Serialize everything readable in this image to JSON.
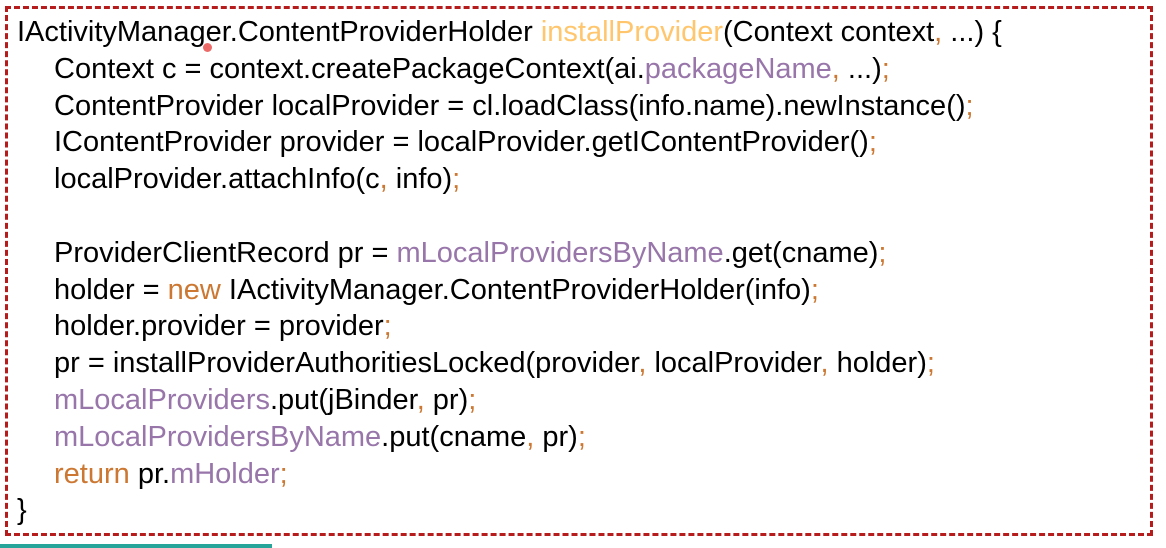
{
  "code": {
    "line_count": 14,
    "lines": [
      {
        "tokens": [
          {
            "text": "IActivityManager.ContentProviderHolder ",
            "role": "plain"
          },
          {
            "text": "installProvider",
            "role": "method"
          },
          {
            "text": "(Context context",
            "role": "plain"
          },
          {
            "text": ",",
            "role": "punct"
          },
          {
            "text": " ...) {",
            "role": "plain"
          }
        ]
      },
      {
        "indent": true,
        "tokens": [
          {
            "text": "Context c = context.createPackageContext(ai.",
            "role": "plain"
          },
          {
            "text": "packageName",
            "role": "field"
          },
          {
            "text": ",",
            "role": "punct"
          },
          {
            "text": " ...)",
            "role": "plain"
          },
          {
            "text": ";",
            "role": "punct"
          }
        ]
      },
      {
        "indent": true,
        "tokens": [
          {
            "text": "ContentProvider localProvider = cl.loadClass(info.name).newInstance()",
            "role": "plain"
          },
          {
            "text": ";",
            "role": "punct"
          }
        ]
      },
      {
        "indent": true,
        "tokens": [
          {
            "text": "IContentProvider provider = localProvider.getIContentProvider()",
            "role": "plain"
          },
          {
            "text": ";",
            "role": "punct"
          }
        ]
      },
      {
        "indent": true,
        "tokens": [
          {
            "text": "localProvider.attachInfo(c",
            "role": "plain"
          },
          {
            "text": ",",
            "role": "punct"
          },
          {
            "text": " info)",
            "role": "plain"
          },
          {
            "text": ";",
            "role": "punct"
          }
        ]
      },
      {
        "blank": true,
        "tokens": []
      },
      {
        "indent": true,
        "tokens": [
          {
            "text": "ProviderClientRecord pr = ",
            "role": "plain"
          },
          {
            "text": "mLocalProvidersByName",
            "role": "field"
          },
          {
            "text": ".get(cname)",
            "role": "plain"
          },
          {
            "text": ";",
            "role": "punct"
          }
        ]
      },
      {
        "indent": true,
        "tokens": [
          {
            "text": "holder = ",
            "role": "plain"
          },
          {
            "text": "new",
            "role": "kw"
          },
          {
            "text": " IActivityManager.ContentProviderHolder(info)",
            "role": "plain"
          },
          {
            "text": ";",
            "role": "punct"
          }
        ]
      },
      {
        "indent": true,
        "tokens": [
          {
            "text": "holder.provider = provider",
            "role": "plain"
          },
          {
            "text": ";",
            "role": "punct"
          }
        ]
      },
      {
        "indent": true,
        "tokens": [
          {
            "text": "pr = installProviderAuthoritiesLocked(provider",
            "role": "plain"
          },
          {
            "text": ",",
            "role": "punct"
          },
          {
            "text": " localProvider",
            "role": "plain"
          },
          {
            "text": ",",
            "role": "punct"
          },
          {
            "text": " holder)",
            "role": "plain"
          },
          {
            "text": ";",
            "role": "punct"
          }
        ]
      },
      {
        "indent": true,
        "tokens": [
          {
            "text": "mLocalProviders",
            "role": "field"
          },
          {
            "text": ".put(jBinder",
            "role": "plain"
          },
          {
            "text": ",",
            "role": "punct"
          },
          {
            "text": " pr)",
            "role": "plain"
          },
          {
            "text": ";",
            "role": "punct"
          }
        ]
      },
      {
        "indent": true,
        "tokens": [
          {
            "text": "mLocalProvidersByName",
            "role": "field"
          },
          {
            "text": ".put(cname",
            "role": "plain"
          },
          {
            "text": ",",
            "role": "punct"
          },
          {
            "text": " pr)",
            "role": "plain"
          },
          {
            "text": ";",
            "role": "punct"
          }
        ]
      },
      {
        "indent": true,
        "tokens": [
          {
            "text": "return",
            "role": "kw"
          },
          {
            "text": " pr.",
            "role": "plain"
          },
          {
            "text": "mHolder",
            "role": "field"
          },
          {
            "text": ";",
            "role": "punct"
          }
        ]
      },
      {
        "tokens": [
          {
            "text": "}",
            "role": "plain"
          }
        ]
      }
    ]
  },
  "colors": {
    "border": "#b71c1c",
    "method": "#ffc66d",
    "punct": "#cc7832",
    "field": "#9876aa",
    "keyword": "#cc7832",
    "text": "#000000"
  }
}
